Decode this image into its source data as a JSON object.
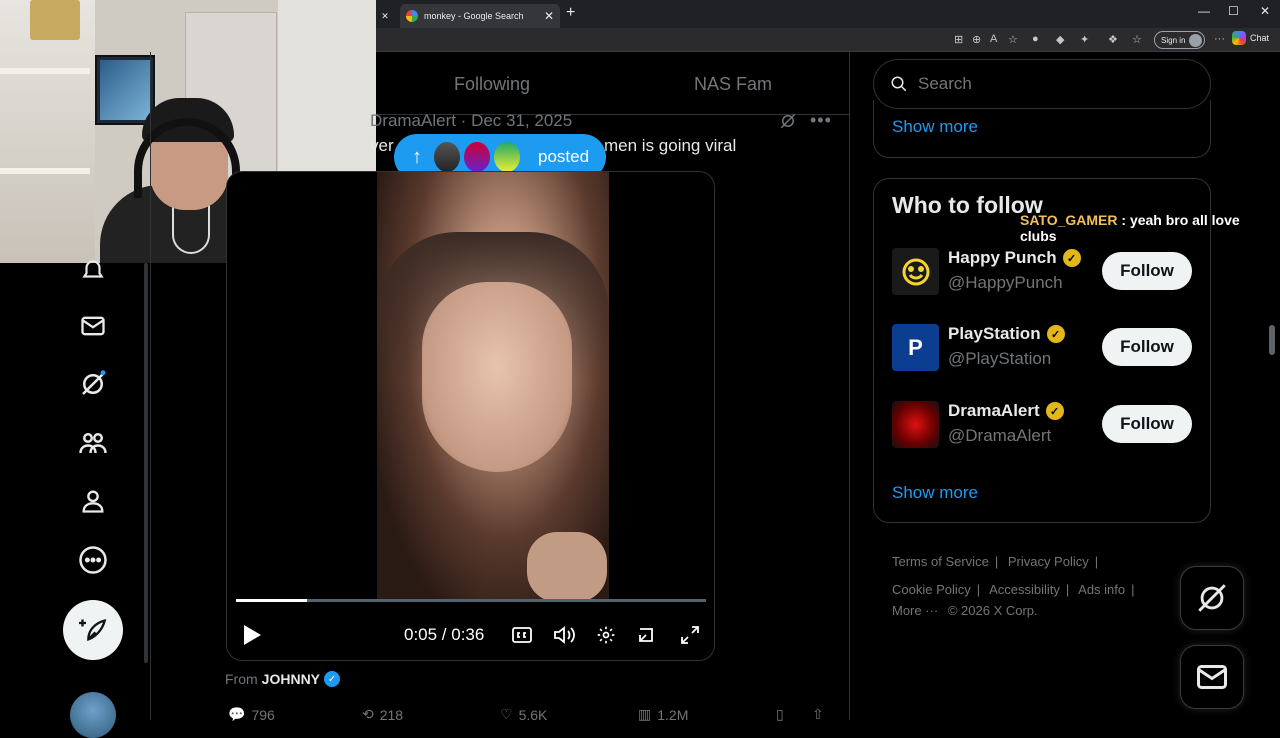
{
  "browser": {
    "tab_title": "monkey - Google Search",
    "tab_close": "✕",
    "new_tab": "+",
    "sign_in": "Sign in",
    "chat": "Chat",
    "window_controls": {
      "minimize": "—",
      "maximize": "☐",
      "close": "✕"
    }
  },
  "x": {
    "tabs": [
      "Following",
      "NAS Fam"
    ],
    "post": {
      "meta": "DramaAlert · Dec 31, 2025",
      "text_left": "ver",
      "text_right": "men is going viral",
      "posted_label": "posted",
      "video": {
        "time": "0:05 / 0:36",
        "progress": 0.15
      },
      "from_prefix": "From",
      "from_name": "JOHNNY",
      "stats": {
        "replies": "796",
        "reposts": "218",
        "likes": "5.6K",
        "views": "1.2M"
      }
    },
    "search_placeholder": "Search",
    "trending_show_more": "Show more",
    "who_to_follow": {
      "title": "Who to follow",
      "accounts": [
        {
          "name": "Happy Punch",
          "handle": "@HappyPunch",
          "button": "Follow"
        },
        {
          "name": "PlayStation",
          "handle": "@PlayStation",
          "button": "Follow"
        },
        {
          "name": "DramaAlert",
          "handle": "@DramaAlert",
          "button": "Follow"
        }
      ],
      "show_more": "Show more"
    },
    "footer": {
      "terms": "Terms of Service",
      "privacy": "Privacy Policy",
      "cookie": "Cookie Policy",
      "accessibility": "Accessibility",
      "ads": "Ads info",
      "more": "More ···",
      "copyright": "© 2026 X Corp."
    }
  },
  "stream_chat": {
    "user": "SATO_GAMER",
    "message": " : yeah bro all love clubs"
  },
  "colors": {
    "accent": "#1d9bf0",
    "verified_gold": "#e2b719"
  }
}
